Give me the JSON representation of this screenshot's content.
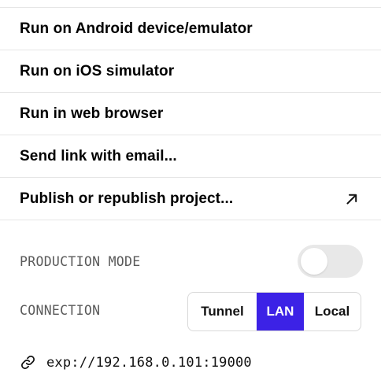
{
  "menu": {
    "items": [
      {
        "label": "Run on Android device/emulator"
      },
      {
        "label": "Run on iOS simulator"
      },
      {
        "label": "Run in web browser"
      },
      {
        "label": "Send link with email..."
      },
      {
        "label": "Publish or republish project...",
        "icon": "external-arrow-icon"
      }
    ]
  },
  "settings": {
    "production_mode": {
      "label": "PRODUCTION MODE",
      "enabled": false
    },
    "connection": {
      "label": "CONNECTION",
      "options": [
        "Tunnel",
        "LAN",
        "Local"
      ],
      "selected": "LAN"
    }
  },
  "url": {
    "icon": "link-icon",
    "text": "exp://192.168.0.101:19000"
  },
  "colors": {
    "accent": "#3c22e6",
    "divider": "#e6e6e6",
    "label_gray": "#5a5a5a",
    "toggle_off": "#e8e8e8"
  }
}
